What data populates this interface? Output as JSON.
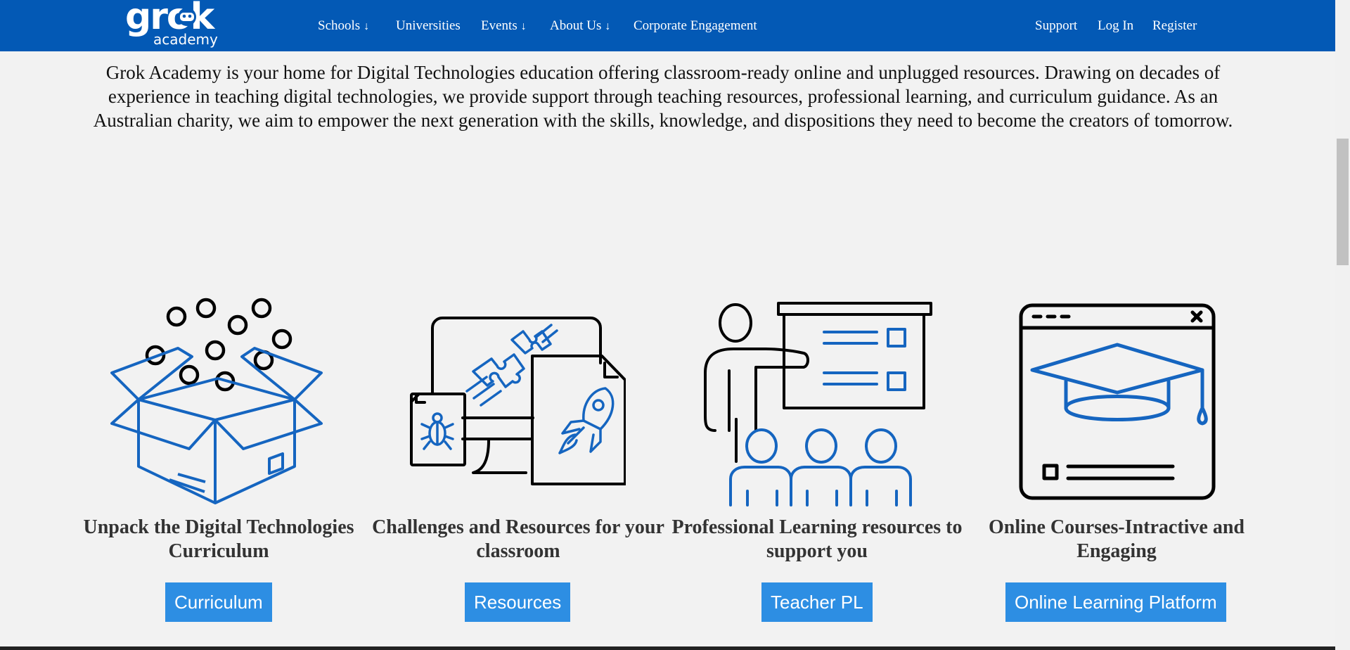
{
  "nav": {
    "logo_word": "grok",
    "logo_sub": "academy",
    "items": [
      {
        "label": "Schools",
        "dropdown": true
      },
      {
        "label": "Universities",
        "dropdown": false
      },
      {
        "label": "Events",
        "dropdown": true
      },
      {
        "label": "About Us",
        "dropdown": true
      },
      {
        "label": "Corporate Engagement",
        "dropdown": false
      }
    ],
    "right": [
      {
        "label": "Support"
      },
      {
        "label": "Log In"
      },
      {
        "label": "Register"
      }
    ],
    "dropdown_glyph": "↓"
  },
  "intro": "Grok Academy is your home for Digital Technologies education offering classroom-ready online and unplugged resources. Drawing on decades of experience in teaching digital technologies, we provide support through teaching resources, professional learning, and curriculum guidance. As an Australian charity, we aim to empower the next generation with the skills, knowledge, and dispositions they need to become the creators of tomorrow.",
  "cards": [
    {
      "title": "Unpack the Digital Technologies Curriculum",
      "button": "Curriculum",
      "icon": "open-box-icon"
    },
    {
      "title": "Challenges and Resources for your classroom",
      "button": "Resources",
      "icon": "monitor-documents-icon"
    },
    {
      "title": "Professional Learning resources to support you",
      "button": "Teacher PL",
      "icon": "teacher-presentation-icon"
    },
    {
      "title": "Online Courses-Intractive and Engaging",
      "button": "Online Learning Platform",
      "icon": "graduation-cap-browser-icon"
    }
  ],
  "colors": {
    "nav_bg": "#0359b5",
    "accent_blue": "#1565c0",
    "button_bg": "#2d8ee3",
    "page_bg": "#f2f2f2"
  }
}
